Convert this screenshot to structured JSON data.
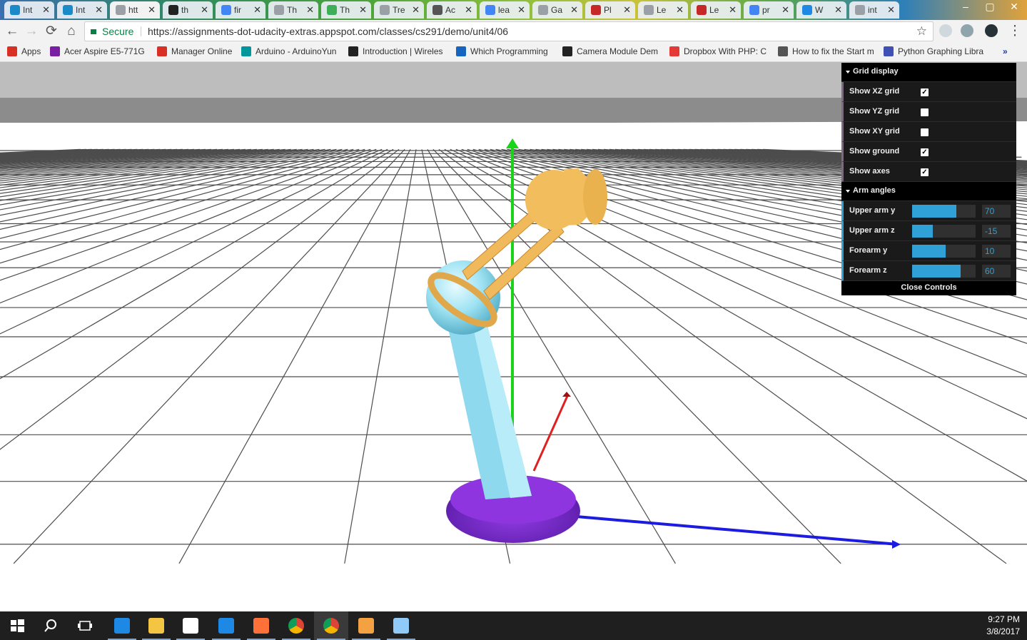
{
  "tabs": [
    {
      "title": "Int",
      "icon": "udacity-icon",
      "color": "#1a8bc8"
    },
    {
      "title": "Int",
      "icon": "udacity-icon",
      "color": "#1a8bc8"
    },
    {
      "title": "htt",
      "icon": "page-icon",
      "color": "#9aa0a6",
      "active": true
    },
    {
      "title": "th",
      "icon": "github-icon",
      "color": "#222222"
    },
    {
      "title": "fir",
      "icon": "google-icon",
      "color": "#4285f4"
    },
    {
      "title": "Th",
      "icon": "page-icon",
      "color": "#9aa0a6"
    },
    {
      "title": "Th",
      "icon": "gear-icon",
      "color": "#3dae5a"
    },
    {
      "title": "Tre",
      "icon": "page-icon",
      "color": "#9aa0a6"
    },
    {
      "title": "Ac",
      "icon": "tool-icon",
      "color": "#555555"
    },
    {
      "title": "lea",
      "icon": "google-icon",
      "color": "#4285f4"
    },
    {
      "title": "Ga",
      "icon": "page-icon",
      "color": "#9aa0a6"
    },
    {
      "title": "Pl",
      "icon": "s-icon",
      "color": "#c62828"
    },
    {
      "title": "Le",
      "icon": "page-icon",
      "color": "#9aa0a6"
    },
    {
      "title": "Le",
      "icon": "bars-icon",
      "color": "#c62828"
    },
    {
      "title": "pr",
      "icon": "google-icon",
      "color": "#4285f4"
    },
    {
      "title": "W",
      "icon": "refresh-icon",
      "color": "#1e88e5"
    },
    {
      "title": "int",
      "icon": "page-icon",
      "color": "#9aa0a6"
    }
  ],
  "toolbar": {
    "secure_label": "Secure",
    "url": "https://assignments-dot-udacity-extras.appspot.com/classes/cs291/demo/unit4/06"
  },
  "bookmarks": [
    {
      "label": "Apps",
      "icon": "apps-icon",
      "color": "#d93025"
    },
    {
      "label": "Acer Aspire E5-771G",
      "icon": "bookmark-icon",
      "color": "#7b1fa2"
    },
    {
      "label": "Manager Online",
      "icon": "gmail-icon",
      "color": "#d93025"
    },
    {
      "label": "Arduino - ArduinoYun",
      "icon": "arduino-icon",
      "color": "#00979c"
    },
    {
      "label": "Introduction | Wireles",
      "icon": "star-icon",
      "color": "#222222"
    },
    {
      "label": "Which Programming",
      "icon": "c-icon",
      "color": "#1565c0"
    },
    {
      "label": "Camera Module Dem",
      "icon": "camera-icon",
      "color": "#222222"
    },
    {
      "label": "Dropbox With PHP: C",
      "icon": "youtube-icon",
      "color": "#e53935"
    },
    {
      "label": "How to fix the Start m",
      "icon": "wiki-icon",
      "color": "#555555"
    },
    {
      "label": "Python Graphing Libra",
      "icon": "chart-icon",
      "color": "#3f51b5"
    }
  ],
  "gui": {
    "grid_display": {
      "title": "Grid display",
      "items": [
        {
          "label": "Show XZ grid",
          "checked": true
        },
        {
          "label": "Show YZ grid",
          "checked": false
        },
        {
          "label": "Show XY grid",
          "checked": false
        },
        {
          "label": "Show ground",
          "checked": true
        },
        {
          "label": "Show axes",
          "checked": true
        }
      ]
    },
    "arm_angles": {
      "title": "Arm angles",
      "items": [
        {
          "label": "Upper arm y",
          "value": "70",
          "fraction": 0.7
        },
        {
          "label": "Upper arm z",
          "value": "-15",
          "fraction": 0.33
        },
        {
          "label": "Forearm y",
          "value": "10",
          "fraction": 0.53
        },
        {
          "label": "Forearm z",
          "value": "60",
          "fraction": 0.76
        }
      ]
    },
    "close_label": "Close Controls"
  },
  "taskbar": {
    "apps": [
      {
        "name": "start-button",
        "color": "#ffffff"
      },
      {
        "name": "search-icon",
        "color": "#ffffff"
      },
      {
        "name": "task-view-icon",
        "color": "#ffffff"
      },
      {
        "name": "edge-icon",
        "color": "#1e88e5"
      },
      {
        "name": "file-explorer-icon",
        "color": "#f4c542"
      },
      {
        "name": "store-icon",
        "color": "#ffffff"
      },
      {
        "name": "ie-icon",
        "color": "#1e88e5"
      },
      {
        "name": "firefox-icon",
        "color": "#ff7139"
      },
      {
        "name": "chrome-icon",
        "color": "#4caf50"
      },
      {
        "name": "chrome-icon",
        "color": "#4caf50"
      },
      {
        "name": "git-icon",
        "color": "#f4a142"
      },
      {
        "name": "settings-window-icon",
        "color": "#90caf9"
      }
    ],
    "time": "9:27 PM",
    "date": "3/8/2017"
  }
}
